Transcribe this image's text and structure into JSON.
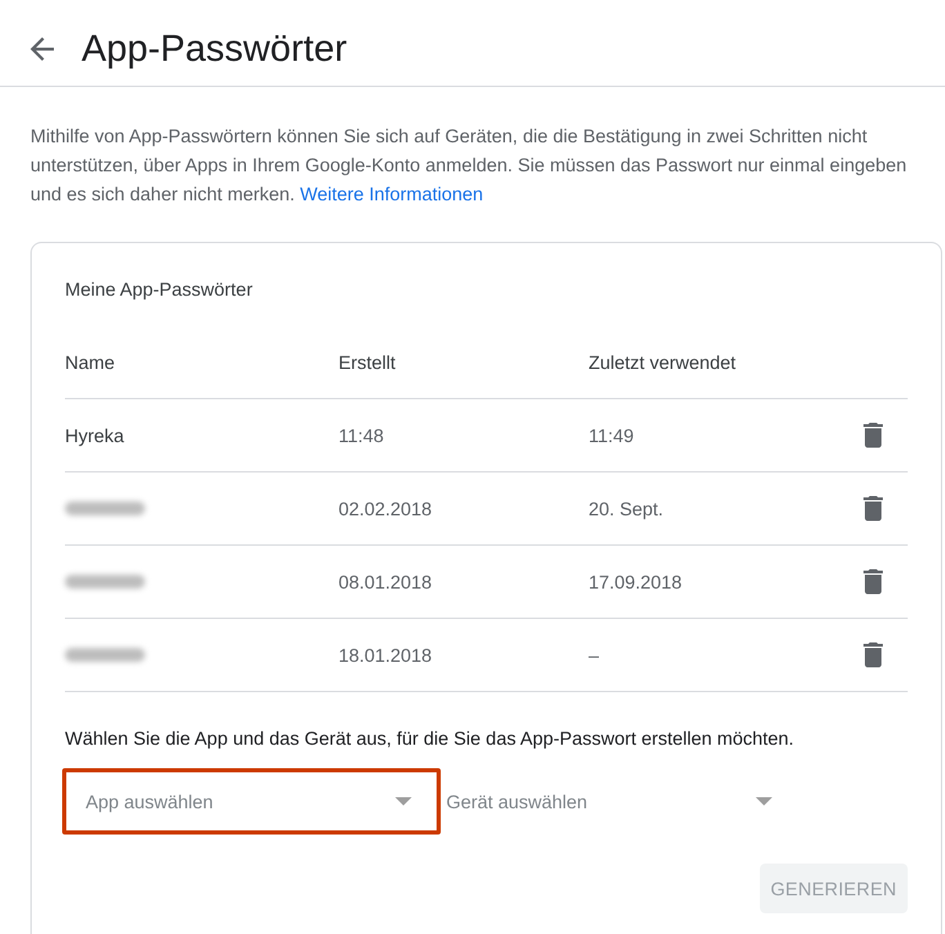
{
  "header": {
    "title": "App-Passwörter"
  },
  "intro": {
    "text": "Mithilfe von App-Passwörtern können Sie sich auf Geräten, die die Bestätigung in zwei Schritten nicht unterstützen, über Apps in Ihrem Google-Konto anmelden. Sie müssen das Passwort nur einmal eingeben und es sich daher nicht merken.",
    "link": "Weitere Informationen"
  },
  "card": {
    "title": "Meine App-Passwörter",
    "table": {
      "columns": [
        "Name",
        "Erstellt",
        "Zuletzt verwendet"
      ],
      "rows": [
        {
          "name": "Hyreka",
          "redacted": false,
          "created": "11:48",
          "last_used": "11:49"
        },
        {
          "redacted": true,
          "created": "02.02.2018",
          "last_used": "20. Sept."
        },
        {
          "redacted": true,
          "created": "08.01.2018",
          "last_used": "17.09.2018"
        },
        {
          "redacted": true,
          "created": "18.01.2018",
          "last_used": "–"
        }
      ]
    },
    "prompt": "Wählen Sie die App und das Gerät aus, für die Sie das App-Passwort erstellen möchten.",
    "selects": [
      {
        "placeholder": "App auswählen",
        "highlighted": true
      },
      {
        "placeholder": "Gerät auswählen",
        "highlighted": false
      }
    ],
    "generate_button": {
      "label": "GENERIEREN",
      "disabled": true
    }
  }
}
